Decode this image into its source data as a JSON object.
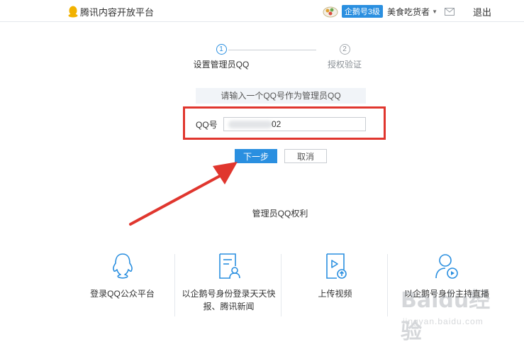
{
  "header": {
    "logo_text": "腾讯内容开放平台",
    "level_badge": "企鹅号3级",
    "username": "美食吃货者",
    "logout": "退出",
    "accent_color": "#2a8fe0"
  },
  "steps": [
    {
      "number": "1",
      "label": "设置管理员QQ",
      "state": "active"
    },
    {
      "number": "2",
      "label": "授权验证",
      "state": "inactive"
    }
  ],
  "form": {
    "notice": "请输入一个QQ号作为管理员QQ",
    "qq_label": "QQ号",
    "qq_visible_suffix": "02",
    "next_button": "下一步",
    "cancel_button": "取消"
  },
  "rights": {
    "title": "管理员QQ权利",
    "items": [
      {
        "icon": "qq-penguin-icon",
        "label": "登录QQ公众平台"
      },
      {
        "icon": "id-card-user-icon",
        "label": "以企鹅号身份登录天天快报、腾讯新闻"
      },
      {
        "icon": "upload-video-icon",
        "label": "上传视频"
      },
      {
        "icon": "live-host-icon",
        "label": "以企鹅号身份主持直播"
      }
    ]
  },
  "watermark": {
    "big": "Baidu经验",
    "small": "jingyan.baidu.com"
  },
  "colors": {
    "highlight": "#e0362e",
    "arrow": "#e0362e",
    "button_primary": "#2a8fe0"
  }
}
